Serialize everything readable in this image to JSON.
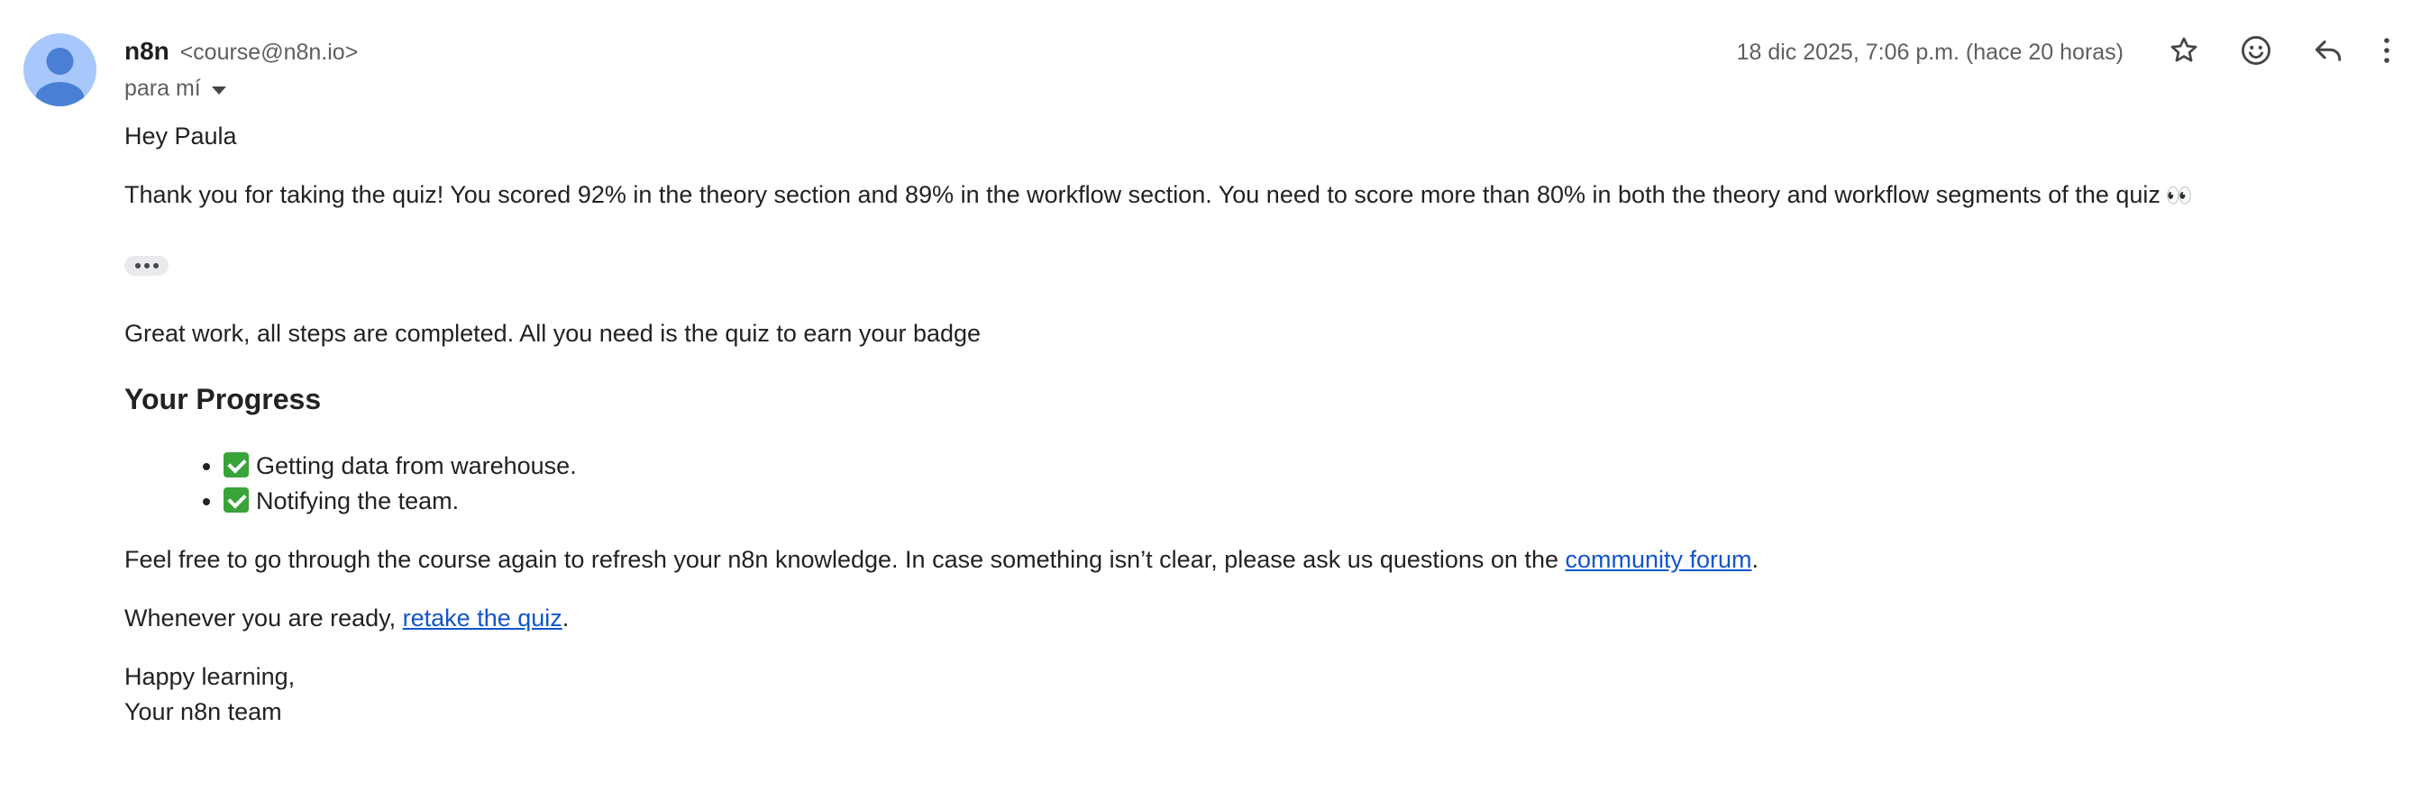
{
  "header": {
    "sender_name": "n8n",
    "sender_email": "<course@n8n.io>",
    "recipient_label": "para mí",
    "datetime": "18 dic 2025, 7:06 p.m. (hace 20 horas)",
    "actions": {
      "star_icon": "star-icon",
      "emoji_icon": "emoji-reaction-icon",
      "reply_icon": "reply-icon",
      "more_icon": "more-vert-icon"
    }
  },
  "body": {
    "greeting": "Hey Paula",
    "intro": "Thank you for taking the quiz! You scored 92% in the theory section and 89% in the workflow section. You need to score more than 80% in both the theory and workflow segments of the quiz",
    "intro_emoji": "👀",
    "status": "Great work, all steps are completed. All you need is the quiz to earn your badge",
    "progress_heading": "Your Progress",
    "progress_items": [
      {
        "label": "Getting data from warehouse."
      },
      {
        "label": "Notifying the team."
      }
    ],
    "refresh_text": "Feel free to go through the course again to refresh your n8n knowledge. In case something isn’t clear, please ask us questions on the ",
    "community_link": "community forum",
    "refresh_end": ".",
    "retake_text": "Whenever you are ready, ",
    "retake_link": "retake the quiz",
    "retake_end": ".",
    "signoff_line1": "Happy learning,",
    "signoff_line2": "Your n8n team"
  },
  "colors": {
    "avatar_bg": "#a8c7fa",
    "avatar_fg": "#4a7fd4",
    "link": "#1155cc",
    "check": "#3aa339"
  }
}
